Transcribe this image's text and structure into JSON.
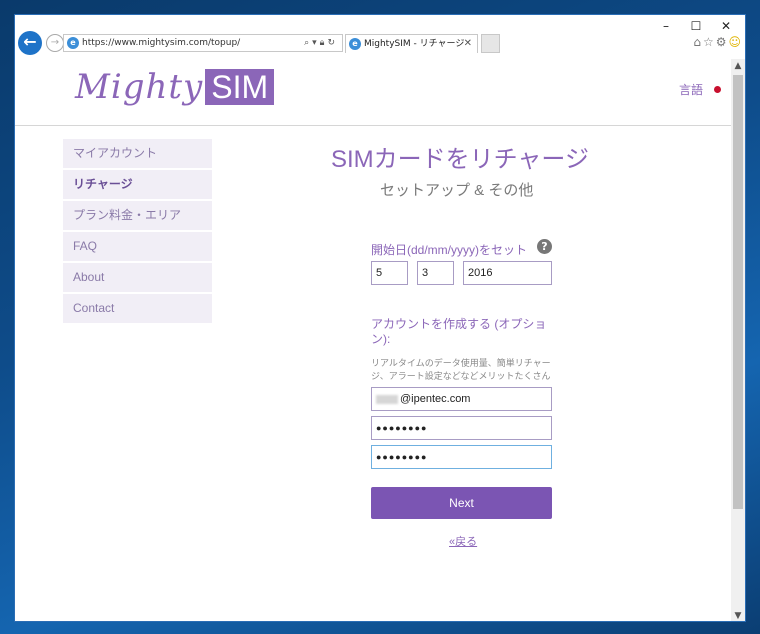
{
  "browser": {
    "address_url": "https://www.mightysim.com/topup/",
    "tab_title": "MightySIM - リチャージ",
    "window_buttons": [
      "–",
      "☐",
      "✕"
    ],
    "tool_icons": [
      "home-icon",
      "star-icon",
      "gear-icon",
      "smiley-icon"
    ]
  },
  "header": {
    "logo_text_1": "Mighty",
    "logo_text_2": "SIM",
    "lang_label": "言語"
  },
  "sidebar": {
    "items": [
      {
        "label": "マイアカウント"
      },
      {
        "label": "リチャージ"
      },
      {
        "label": "プラン料金・エリア"
      },
      {
        "label": "FAQ"
      },
      {
        "label": "About"
      },
      {
        "label": "Contact"
      }
    ]
  },
  "main": {
    "title": "SIMカードをリチャージ",
    "subtitle": "セットアップ & その他",
    "date_label": "開始日(dd/mm/yyyy)をセット",
    "date": {
      "day": "5",
      "month": "3",
      "year": "2016"
    },
    "account_label": "アカウントを作成する (オプション):",
    "account_hint": "リアルタイムのデータ使用量、簡単リチャージ、アラート設定などなどメリットたくさん",
    "email_value": "@ipentec.com",
    "password_value": "●●●●●●●●",
    "password_confirm_value": "●●●●●●●●",
    "next_label": "Next",
    "back_label": "«戻る"
  }
}
